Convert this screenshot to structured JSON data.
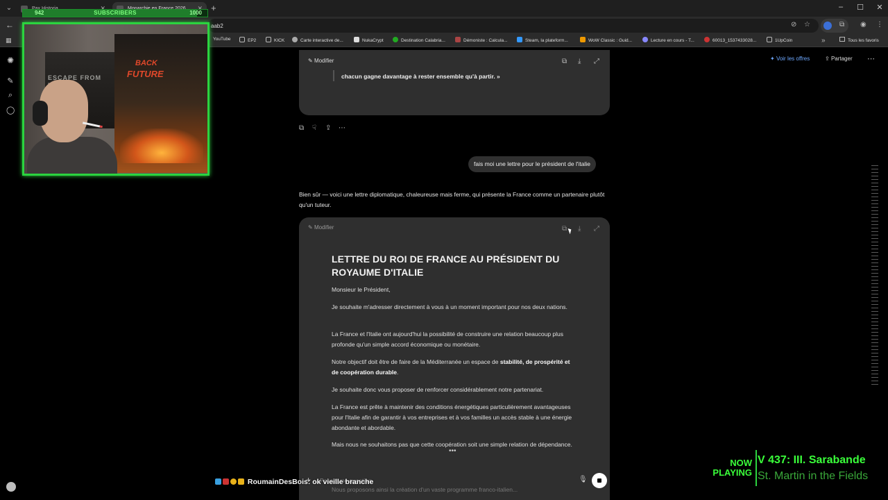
{
  "browser": {
    "tabs": [
      {
        "title": "Pax Historia"
      },
      {
        "title": "Monarchie en France 2026"
      }
    ],
    "url": "aab2",
    "bookmarks": [
      {
        "label": "YouTube",
        "color": "#e33"
      },
      {
        "label": "EP2",
        "color": "#888"
      },
      {
        "label": "KICK",
        "color": "#888"
      },
      {
        "label": "Carte interactive de...",
        "color": "#aaa"
      },
      {
        "label": "NukaCrypt",
        "color": "#ddd"
      },
      {
        "label": "Destination Calabria...",
        "color": "#2a2"
      },
      {
        "label": "Démoniste : Calcula...",
        "color": "#a44"
      },
      {
        "label": "Steam, la plateform...",
        "color": "#39f"
      },
      {
        "label": "WoW Classic : Guid...",
        "color": "#e90"
      },
      {
        "label": "Lecture en cours - T...",
        "color": "#88f"
      },
      {
        "label": "60013_1537433028...",
        "color": "#c33"
      },
      {
        "label": "1UpCoin",
        "color": "#888"
      }
    ],
    "all_bookmarks": "Tous les favoris"
  },
  "header": {
    "offers": "Voir les offres",
    "share": "Partager"
  },
  "top_card": {
    "edit_label": "Modifier",
    "quote": "chacun gagne davantage à rester ensemble qu'à partir. »"
  },
  "user_message": "fais moi une lettre pour le président de l'italie",
  "assistant_intro": "Bien sûr — voici une lettre diplomatique, chaleureuse mais ferme, qui présente la France comme un partenaire plutôt qu'un tuteur.",
  "letter": {
    "edit_label": "Modifier",
    "title": "LETTRE DU ROI DE FRANCE AU PRÉSIDENT DU ROYAUME D'ITALIE",
    "salutation": "Monsieur le Président,",
    "p1": "Je souhaite m'adresser directement à vous à un moment important pour nos deux nations.",
    "p2": "La France et l'Italie ont aujourd'hui la possibilité de construire une relation beaucoup plus profonde qu'un simple accord économique ou monétaire.",
    "p3_start": "Notre objectif doit être de faire de la Méditerranée un espace de ",
    "p3_bold": "stabilité, de prospérité et de coopération durable",
    "p3_end": ".",
    "p4": "Je souhaite donc vous proposer de renforcer considérablement notre partenariat.",
    "p5": "La France est prête à maintenir des conditions énergétiques particulièrement avantageuses pour l'Italie afin de garantir à vos entreprises et à vos familles un accès stable à une énergie abondante et abordable.",
    "p6": "Mais nous ne souhaitons pas que cette coopération soit une simple relation de dépendance.",
    "p7": "Nous proposons ainsi la création d'un vaste programme franco-italien..."
  },
  "composer": {
    "placeholder": "Posez une question"
  },
  "overlay": {
    "sub_current": "942",
    "sub_label": "SUBSCRIBERS",
    "sub_goal": "1000",
    "sub_progress": 0.942,
    "webcam_poster1": "ESCAPE FROM TARKOV",
    "webcam_poster2_a": "BACK",
    "webcam_poster2_b": "FUTURE",
    "now_playing": "NOW PLAYING",
    "track_title": "V 437: III. Sarabande",
    "track_artist": "St. Martin in the Fields",
    "chat_user": "RoumainDesBois",
    "chat_text": ": ok vieille branche"
  },
  "colors": {
    "overlay_green": "#2bd43f",
    "link_blue": "#6ea8ff",
    "card_bg": "#2f2f2f"
  },
  "icons": {
    "edit": "pencil-icon",
    "copy": "copy-icon",
    "download": "download-icon",
    "expand": "expand-icon",
    "dislike": "thumbs-down-icon",
    "share": "share-icon",
    "more": "more-dots-icon"
  }
}
